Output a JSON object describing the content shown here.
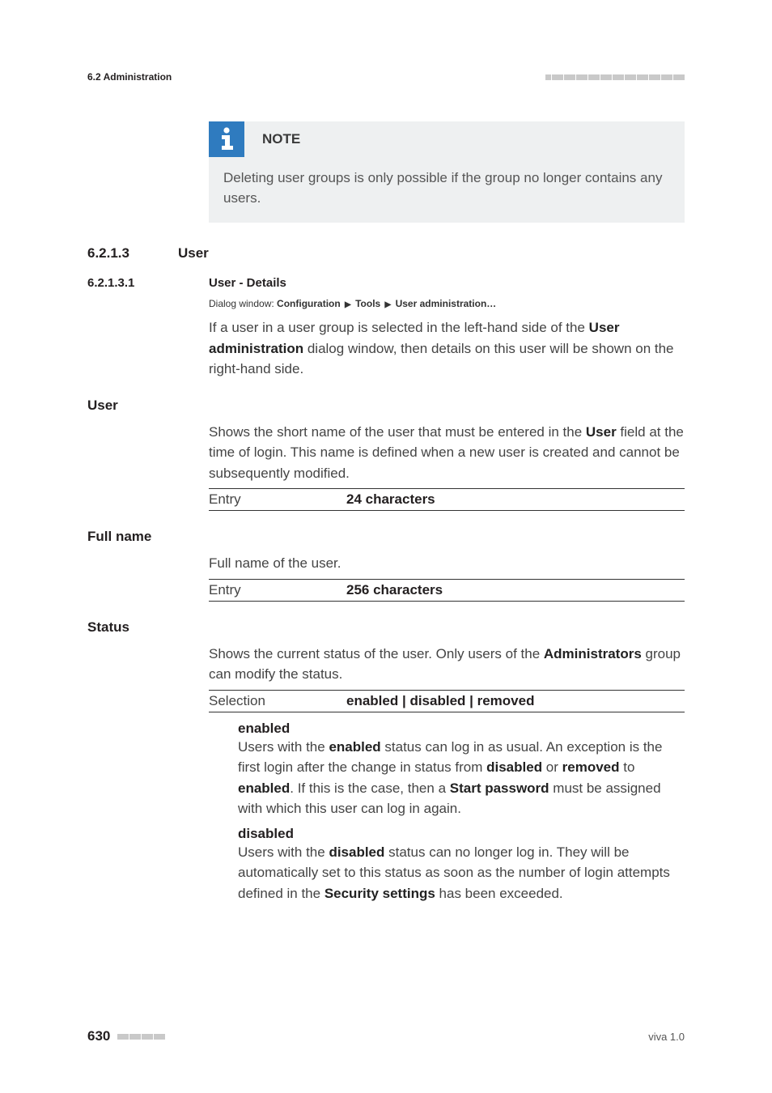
{
  "header": {
    "section_ref": "6.2 Administration"
  },
  "note": {
    "title": "NOTE",
    "body": "Deleting user groups is only possible if the group no longer contains any users."
  },
  "sec": {
    "num": "6.2.1.3",
    "title": "User"
  },
  "subsec": {
    "num": "6.2.1.3.1",
    "title": "User - Details"
  },
  "dialog": {
    "label": "Dialog window: ",
    "p1": "Configuration",
    "p2": "Tools",
    "p3": "User administration…"
  },
  "intro": {
    "t1": "If a user in a user group is selected in the left-hand side of the ",
    "b1": "User administration",
    "t2": " dialog window, then details on this user will be shown on the right-hand side."
  },
  "user_field": {
    "label": "User",
    "t1": "Shows the short name of the user that must be entered in the ",
    "b1": "User",
    "t2": " field at the time of login. This name is defined when a new user is created and cannot be subsequently modified.",
    "entry_label": "Entry",
    "entry_value": "24 characters"
  },
  "fullname_field": {
    "label": "Full name",
    "desc": "Full name of the user.",
    "entry_label": "Entry",
    "entry_value": "256 characters"
  },
  "status_field": {
    "label": "Status",
    "t1": "Shows the current status of the user. Only users of the ",
    "b1": "Administrators",
    "t2": " group can modify the status.",
    "sel_label": "Selection",
    "sel_value": "enabled | disabled | removed"
  },
  "enabled_def": {
    "title": "enabled",
    "t1": "Users with the ",
    "b1": "enabled",
    "t2": " status can log in as usual. An exception is the first login after the change in status from ",
    "b2": "disabled",
    "t3": " or ",
    "b3": "removed",
    "t4": " to ",
    "b4": "enabled",
    "t5": ". If this is the case, then a ",
    "b5": "Start password",
    "t6": " must be assigned with which this user can log in again."
  },
  "disabled_def": {
    "title": "disabled",
    "t1": "Users with the ",
    "b1": "disabled",
    "t2": " status can no longer log in. They will be automatically set to this status as soon as the number of login attempts defined in the ",
    "b2": "Security settings",
    "t3": " has been exceeded."
  },
  "footer": {
    "page": "630",
    "right": "viva 1.0"
  }
}
